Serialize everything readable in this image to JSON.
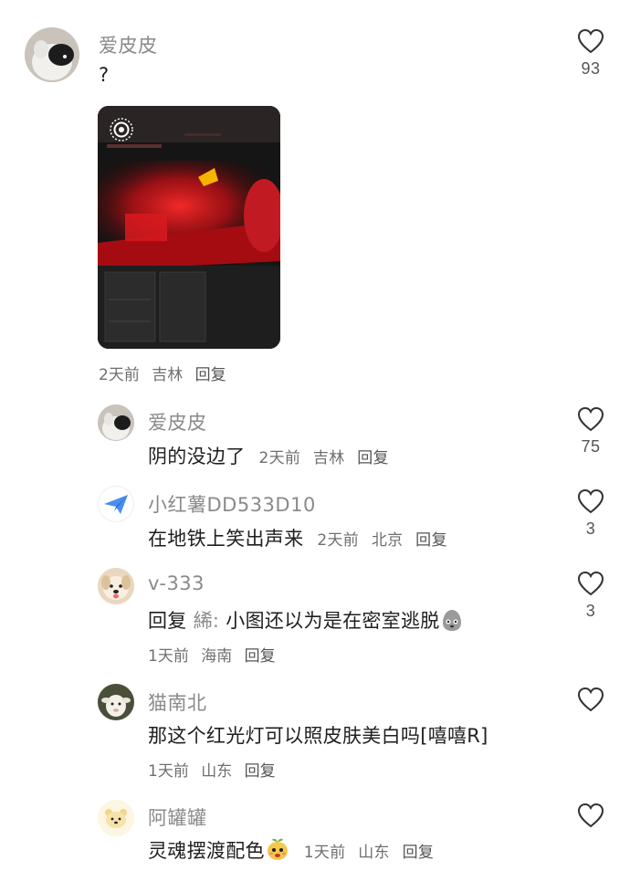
{
  "comments": [
    {
      "name": "爱皮皮",
      "text": "?",
      "likes": "93",
      "meta": {
        "time": "2天前",
        "location": "吉林",
        "reply": "回复"
      },
      "avatar_icon": "dog-avatar-icon"
    },
    {
      "name": "爱皮皮",
      "text": "阴的没边了",
      "likes": "75",
      "meta": {
        "time": "2天前",
        "location": "吉林",
        "reply": "回复"
      },
      "avatar_icon": "dog-avatar-icon"
    },
    {
      "name": "小红薯DD533D10",
      "text": "在地铁上笑出声来",
      "likes": "3",
      "meta": {
        "time": "2天前",
        "location": "北京",
        "reply": "回复"
      },
      "avatar_icon": "paper-plane-icon"
    },
    {
      "name": "v-333",
      "reply_prefix": "回复",
      "reply_to": "絺:",
      "text": "小图还以为是在密室逃脱",
      "likes": "3",
      "meta": {
        "time": "1天前",
        "location": "海南",
        "reply": "回复"
      },
      "avatar_icon": "puppy-avatar-icon"
    },
    {
      "name": "猫南北",
      "text": "那这个红光灯可以照皮肤美白吗[嘻嘻R]",
      "likes": "",
      "meta": {
        "time": "1天前",
        "location": "山东",
        "reply": "回复"
      },
      "avatar_icon": "lamb-avatar-icon"
    },
    {
      "name": "阿罐罐",
      "text": "灵魂摆渡配色",
      "likes": "",
      "meta": {
        "time": "1天前",
        "location": "山东",
        "reply": "回复"
      },
      "avatar_icon": "bear-avatar-icon"
    }
  ],
  "colors": {
    "name": "#8a8a8a",
    "text": "#1f1f1f",
    "meta": "#6f6f6f",
    "photo_red": "#e0141c"
  }
}
